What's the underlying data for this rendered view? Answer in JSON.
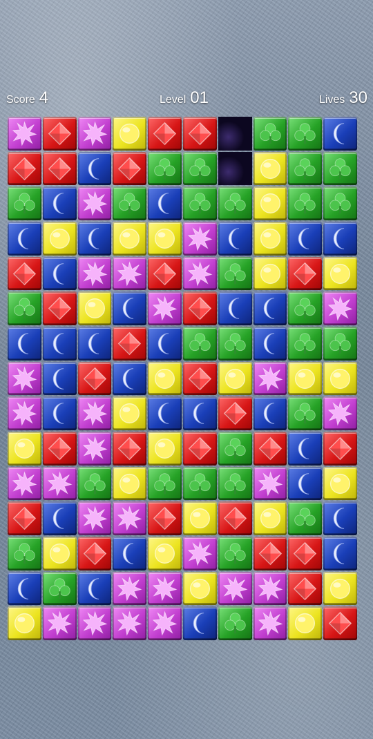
{
  "hud": {
    "score_label": "Score",
    "score_value": "4",
    "level_label": "Level",
    "level_value": "01",
    "lives_label": "Lives",
    "lives_value": "30"
  },
  "colors": {
    "red": "#d71616",
    "green": "#26a226",
    "blue": "#1a3fb8",
    "yellow": "#ece420",
    "purple": "#c23fd0"
  },
  "icons": {
    "R": "red-gem-icon",
    "G": "green-clover-icon",
    "B": "blue-moon-icon",
    "Y": "yellow-orb-icon",
    "P": "purple-star-icon"
  },
  "board": {
    "columns": 10,
    "rows": [
      "PRPYRR.GGB",
      "RRBRGG.YGG",
      "GBPGBGGYGG",
      "BYBYYPBYBB",
      "RBPPRPGYRY",
      "GRYBPRBBGP",
      "BBBRBGGBGG",
      "PBRBYRYPYY",
      "PBPYBBRBGP",
      "YRPRYRGRBR",
      "PPGYGGGPBY",
      "RBPPRYRYGB",
      "GYRBYPGRRB",
      "BGBPPYPPRY",
      "YPPPPBGPYR"
    ]
  }
}
